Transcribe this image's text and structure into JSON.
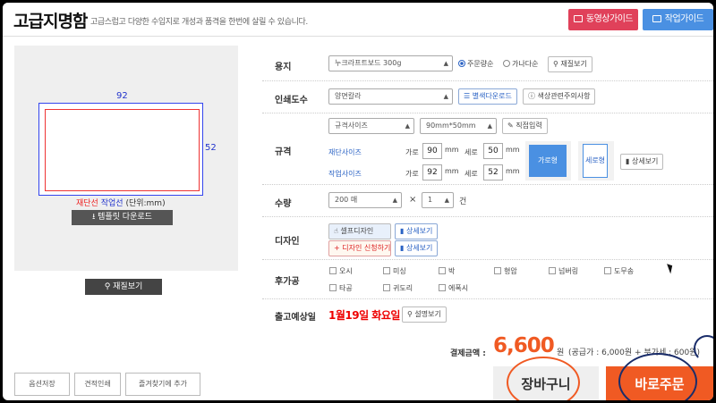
{
  "header": {
    "title": "고급지명함",
    "subtitle": "고급스럽고 다양한 수입지로 개성과 품격을 한번에 살릴 수 있습니다.",
    "video_guide": "동영상가이드",
    "work_guide": "작업가이드"
  },
  "preview": {
    "width_label": "92",
    "height_label": "52",
    "legend_cut": "재단선",
    "legend_work": "작업선",
    "legend_unit": "(단위:mm)",
    "template_download": "템플릿 다운로드",
    "material_view": "재질보기"
  },
  "form": {
    "paper": {
      "label": "용지",
      "selected": "누크라프트보드 300g",
      "option_order": "주문량순",
      "option_alpha": "가나다순",
      "material_view": "재질보기"
    },
    "print": {
      "label": "인쇄도수",
      "selected": "양면칼라",
      "color_download": "별색다운로드",
      "color_notice": "색상관련주의사항"
    },
    "size": {
      "label": "규격",
      "type_selected": "규격사이즈",
      "dims_selected": "90mm*50mm",
      "direct_input": "직접입력",
      "cut_size": "재단사이즈",
      "work_size": "작업사이즈",
      "width_text": "가로",
      "height_text": "세로",
      "unit": "mm",
      "cut_w": "90",
      "cut_h": "50",
      "work_w": "92",
      "work_h": "52",
      "landscape": "가로형",
      "portrait": "세로형",
      "detail": "상세보기"
    },
    "quantity": {
      "label": "수량",
      "selected": "200 매",
      "times": "×",
      "count": "1",
      "unit": "건"
    },
    "design": {
      "label": "디자인",
      "self_design": "셀프디자인",
      "request_design": "디자인 신청하기",
      "detail": "상세보기"
    },
    "finishing": {
      "label": "후가공",
      "options": [
        "오시",
        "미싱",
        "박",
        "형압",
        "넘버링",
        "도무송",
        "타공",
        "귀도리",
        "에폭시"
      ]
    },
    "ship": {
      "label": "출고예상일",
      "date": "1월19일  화요일",
      "explain": "설명보기"
    }
  },
  "price": {
    "label": "결제금액 :",
    "amount": "6,600",
    "unit": "원",
    "detail": "(공급가 : 6,000원 + 부가세 : 600원)"
  },
  "bottom": {
    "save_option": "옵션저장",
    "estimate_print": "견적인쇄",
    "add_favorite": "즐겨찾기에 추가",
    "cart": "장바구니",
    "order_now": "바로주문"
  },
  "colors": {
    "accent_orange": "#f05a23",
    "video_btn": "#e0415a",
    "guide_btn": "#4a90e2",
    "ship_date": "#ee0000"
  }
}
